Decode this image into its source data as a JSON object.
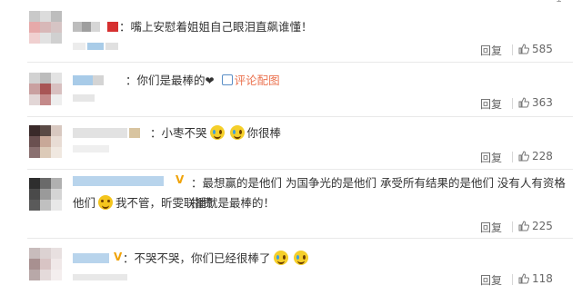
{
  "top_count_partial": "1",
  "comments": [
    {
      "text": "：嘴上安慰着姐姐自己眼泪直飙谁懂！",
      "reply": "回复",
      "likes": "585"
    },
    {
      "text_before": "：你们是最棒的",
      "heart": "❤",
      "link": "评论配图",
      "reply": "回复",
      "likes": "363"
    },
    {
      "text": "：小枣不哭",
      "after_emojis": "你很棒",
      "reply": "回复",
      "likes": "228"
    },
    {
      "line1": "：最想赢的是他们 为国争光的是他们 承受所有结果的是他们 没有人有资格指责",
      "line2_prefix": "他们",
      "line2_suffix": "我不管，昕雯联播就是最棒的！",
      "reply": "回复",
      "likes": "225"
    },
    {
      "text": "：不哭不哭，你们已经很棒了",
      "reply": "回复",
      "likes": "118"
    }
  ],
  "icons": {
    "like": "thumb-up-icon",
    "cry": "crying-face-emoji",
    "smile": "smiling-face-emoji",
    "picture": "picture-icon",
    "verified": "gold-v-badge"
  },
  "colors": {
    "link": "#eb7350",
    "verified": "#f0a30a",
    "text": "#333333",
    "muted": "#666666"
  }
}
